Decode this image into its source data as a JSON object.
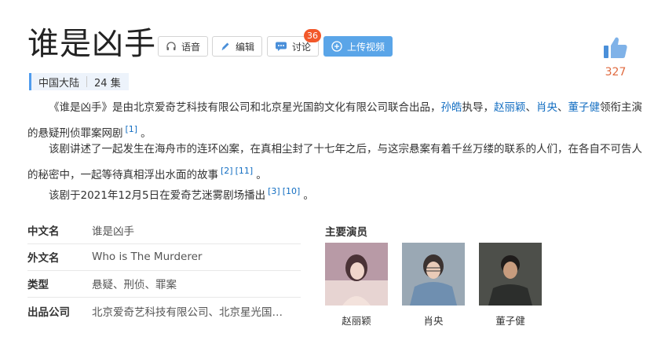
{
  "title": "谁是凶手",
  "toolbar": {
    "voice_label": "语音",
    "edit_label": "编辑",
    "discuss_label": "讨论",
    "discuss_count": "36",
    "upload_label": "上传视频"
  },
  "like": {
    "count": "327"
  },
  "tags": {
    "region": "中国大陆",
    "episodes": "24 集"
  },
  "intro": {
    "p1": {
      "a": "《谁是凶手》是由北京爱奇艺科技有限公司和北京星光国韵文化有限公司联合出品，",
      "director": "孙皓",
      "b": "执导，",
      "actor1": "赵丽颖",
      "c": "、",
      "actor2": "肖央",
      "d": "、",
      "actor3": "董子健",
      "e": "领衔主演的悬疑刑侦罪案网剧",
      "ref1": "[1]",
      "end": "。"
    },
    "p2": {
      "text": "该剧讲述了一起发生在海舟市的连环凶案，在真相尘封了十七年之后，与这宗悬案有着千丝万缕的联系的人们，在各自不可告人的秘密中，一起等待真相浮出水面的故事",
      "ref1": "[2]",
      "ref2": "[11]",
      "end": "。"
    },
    "p3": {
      "text": "该剧于2021年12月5日在爱奇艺迷雾剧场播出",
      "ref1": "[3]",
      "ref2": "[10]",
      "end": "。"
    }
  },
  "info": [
    {
      "key": "中文名",
      "value": "谁是凶手"
    },
    {
      "key": "外文名",
      "value": "Who is The Murderer"
    },
    {
      "key": "类型",
      "value": "悬疑、刑侦、罪案"
    },
    {
      "key": "出品公司",
      "value": "北京爱奇艺科技有限公司、北京星光国…"
    }
  ],
  "cast": {
    "title": "主要演员",
    "members": [
      {
        "name": "赵丽颖"
      },
      {
        "name": "肖央"
      },
      {
        "name": "董子健"
      }
    ]
  },
  "colors": {
    "accent": "#5aa5e8",
    "link": "#136ec2",
    "badge": "#f2582a",
    "like": "#e06a3f"
  }
}
